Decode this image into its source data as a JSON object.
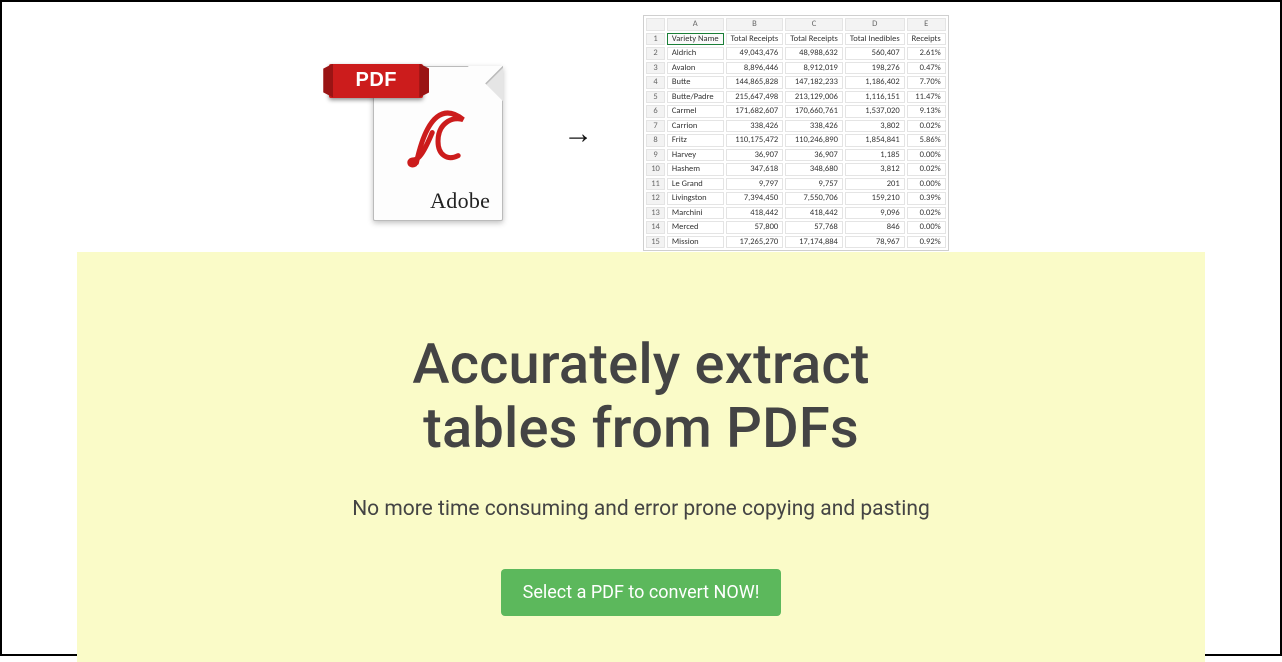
{
  "pdf": {
    "badge": "PDF",
    "brand": "Adobe"
  },
  "arrow": "→",
  "excel": {
    "cols": [
      "",
      "A",
      "B",
      "C",
      "D",
      "E"
    ],
    "header": [
      "Variety Name",
      "Total Receipts",
      "Total Receipts",
      "Total Inedibles",
      "Receipts"
    ],
    "rows": [
      {
        "n": "2",
        "name": "Aldrich",
        "b": "49,043,476",
        "c": "48,988,632",
        "d": "560,407",
        "e": "2.61%"
      },
      {
        "n": "3",
        "name": "Avalon",
        "b": "8,896,446",
        "c": "8,912,019",
        "d": "198,276",
        "e": "0.47%"
      },
      {
        "n": "4",
        "name": "Butte",
        "b": "144,865,828",
        "c": "147,182,233",
        "d": "1,186,402",
        "e": "7.70%"
      },
      {
        "n": "5",
        "name": "Butte/Padre",
        "b": "215,647,498",
        "c": "213,129,006",
        "d": "1,116,151",
        "e": "11.47%"
      },
      {
        "n": "6",
        "name": "Carmel",
        "b": "171,682,607",
        "c": "170,660,761",
        "d": "1,537,020",
        "e": "9.13%"
      },
      {
        "n": "7",
        "name": "Carrion",
        "b": "338,426",
        "c": "338,426",
        "d": "3,802",
        "e": "0.02%"
      },
      {
        "n": "8",
        "name": "Fritz",
        "b": "110,175,472",
        "c": "110,246,890",
        "d": "1,854,841",
        "e": "5.86%"
      },
      {
        "n": "9",
        "name": "Harvey",
        "b": "36,907",
        "c": "36,907",
        "d": "1,185",
        "e": "0.00%"
      },
      {
        "n": "10",
        "name": "Hashem",
        "b": "347,618",
        "c": "348,680",
        "d": "3,812",
        "e": "0.02%"
      },
      {
        "n": "11",
        "name": "Le Grand",
        "b": "9,797",
        "c": "9,757",
        "d": "201",
        "e": "0.00%"
      },
      {
        "n": "12",
        "name": "Livingston",
        "b": "7,394,450",
        "c": "7,550,706",
        "d": "159,210",
        "e": "0.39%"
      },
      {
        "n": "13",
        "name": "Marchini",
        "b": "418,442",
        "c": "418,442",
        "d": "9,096",
        "e": "0.02%"
      },
      {
        "n": "14",
        "name": "Merced",
        "b": "57,800",
        "c": "57,768",
        "d": "846",
        "e": "0.00%"
      },
      {
        "n": "15",
        "name": "Mission",
        "b": "17,265,270",
        "c": "17,174,884",
        "d": "78,967",
        "e": "0.92%"
      }
    ]
  },
  "hero": {
    "title_line1": "Accurately extract",
    "title_line2": "tables from PDFs",
    "subtitle": "No more time consuming and error prone copying and pasting",
    "cta": "Select a PDF to convert NOW!"
  }
}
